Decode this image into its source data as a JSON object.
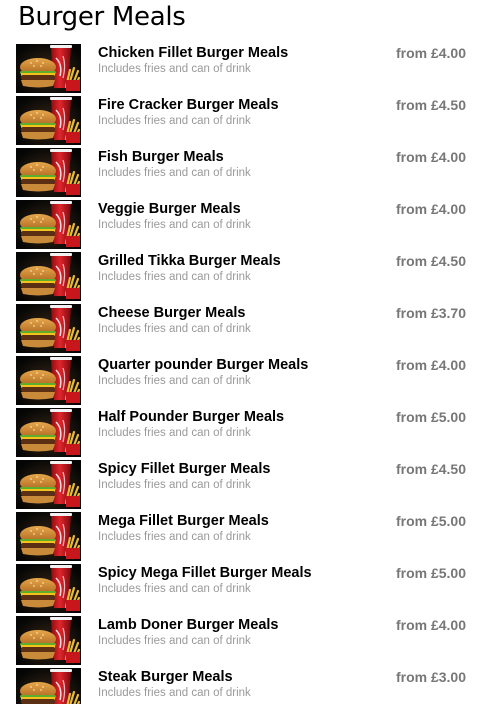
{
  "header": {
    "title": "Burger Meals"
  },
  "colors": {
    "price": "#777777",
    "description": "#9a9a9a",
    "cup_red": "#c8161d",
    "fries": "#e8b93a",
    "thumb_bg": "#0b0b0b"
  },
  "thumbnail_icon": "burger-meal-thumbnail",
  "items": [
    {
      "name": "Chicken Fillet Burger Meals",
      "description": "Includes fries and can of drink",
      "price": "from £4.00"
    },
    {
      "name": "Fire Cracker Burger Meals",
      "description": "Includes fries and can of drink",
      "price": "from £4.50"
    },
    {
      "name": "Fish Burger Meals",
      "description": "Includes fries and can of drink",
      "price": "from £4.00"
    },
    {
      "name": "Veggie Burger Meals",
      "description": "Includes fries and can of drink",
      "price": "from £4.00"
    },
    {
      "name": "Grilled Tikka Burger Meals",
      "description": "Includes fries and can of drink",
      "price": "from £4.50"
    },
    {
      "name": "Cheese Burger Meals",
      "description": "Includes fries and can of drink",
      "price": "from £3.70"
    },
    {
      "name": "Quarter pounder Burger Meals",
      "description": "Includes fries and can of drink",
      "price": "from £4.00"
    },
    {
      "name": "Half Pounder Burger Meals",
      "description": "Includes fries and can of drink",
      "price": "from £5.00"
    },
    {
      "name": "Spicy Fillet Burger Meals",
      "description": "Includes fries and can of drink",
      "price": "from £4.50"
    },
    {
      "name": "Mega Fillet Burger Meals",
      "description": "Includes fries and can of drink",
      "price": "from £5.00"
    },
    {
      "name": "Spicy Mega Fillet Burger Meals",
      "description": "Includes fries and can of drink",
      "price": "from £5.00"
    },
    {
      "name": "Lamb Doner Burger Meals",
      "description": "Includes fries and can of drink",
      "price": "from £4.00"
    },
    {
      "name": "Steak Burger Meals",
      "description": "Includes fries and can of drink",
      "price": "from £3.00"
    }
  ]
}
